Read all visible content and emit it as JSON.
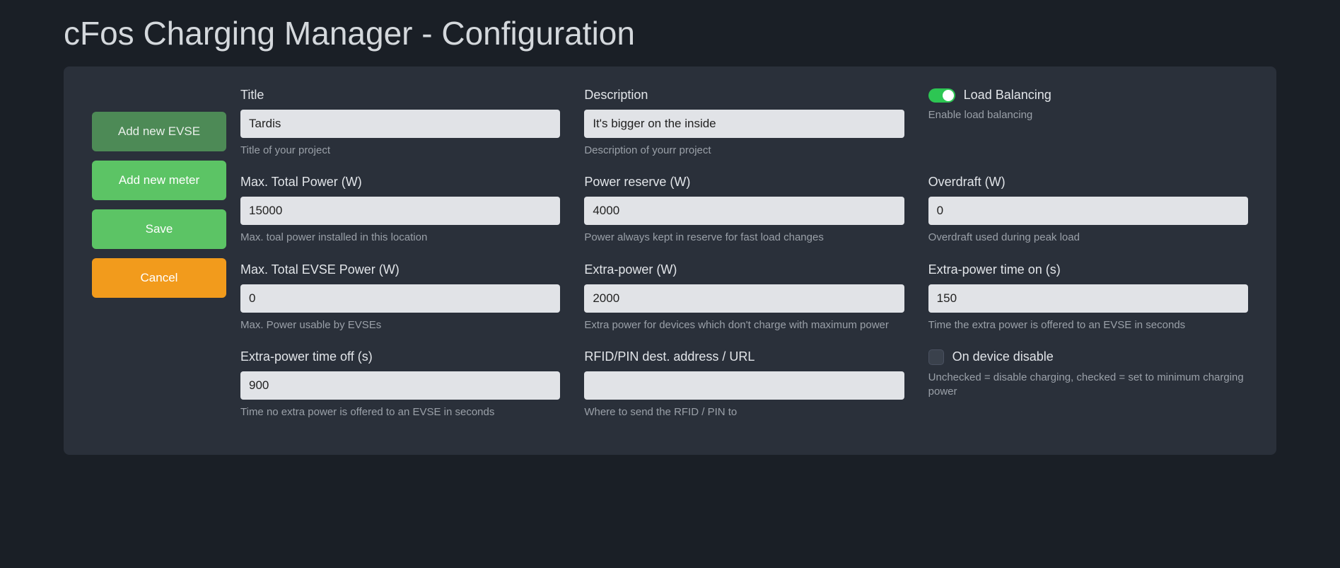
{
  "page": {
    "title": "cFos Charging Manager - Configuration"
  },
  "sidebar": {
    "add_evse": "Add new EVSE",
    "add_meter": "Add new meter",
    "save": "Save",
    "cancel": "Cancel"
  },
  "fields": {
    "title": {
      "label": "Title",
      "value": "Tardis",
      "help": "Title of your project"
    },
    "description": {
      "label": "Description",
      "value": "It's bigger on the inside",
      "help": "Description of yourr project"
    },
    "load_bal": {
      "label": "Load Balancing",
      "help": "Enable load balancing",
      "on": true
    },
    "max_total_power": {
      "label": "Max. Total Power (W)",
      "value": "15000",
      "help": "Max. toal power installed in this location"
    },
    "power_reserve": {
      "label": "Power reserve (W)",
      "value": "4000",
      "help": "Power always kept in reserve for fast load changes"
    },
    "overdraft": {
      "label": "Overdraft (W)",
      "value": "0",
      "help": "Overdraft used during peak load"
    },
    "max_evse_power": {
      "label": "Max. Total EVSE Power (W)",
      "value": "0",
      "help": "Max. Power usable by EVSEs"
    },
    "extra_power": {
      "label": "Extra-power (W)",
      "value": "2000",
      "help": "Extra power for devices which don't charge with maximum power"
    },
    "extra_time_on": {
      "label": "Extra-power time on (s)",
      "value": "150",
      "help": "Time the extra power is offered to an EVSE in seconds"
    },
    "extra_time_off": {
      "label": "Extra-power time off (s)",
      "value": "900",
      "help": "Time no extra power is offered to an EVSE in seconds"
    },
    "rfid_url": {
      "label": "RFID/PIN dest. address / URL",
      "value": "",
      "help": "Where to send the RFID / PIN to"
    },
    "on_dev_disable": {
      "label": "On device disable",
      "help": "Unchecked = disable charging, checked = set to minimum charging power",
      "checked": false
    }
  }
}
